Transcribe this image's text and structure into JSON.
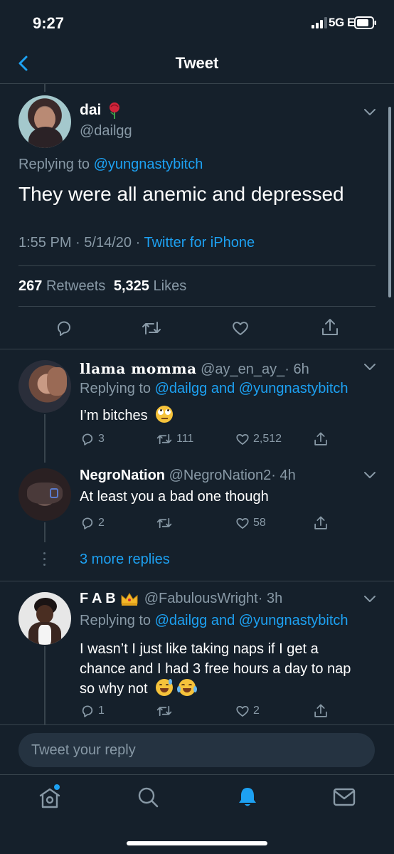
{
  "status_bar": {
    "time": "9:27",
    "network": "5G E"
  },
  "nav": {
    "title": "Tweet"
  },
  "main_tweet": {
    "display_name": "dai",
    "handle": "@dailgg",
    "replying_prefix": "Replying to ",
    "replying_to": "@yungnastybitch",
    "text": "They were all anemic and depressed",
    "time": "1:55 PM",
    "date": "5/14/20",
    "sep1": "·",
    "sep2": "·",
    "source": "Twitter for iPhone",
    "retweets_count": "267",
    "retweets_label": "Retweets",
    "likes_count": "5,325",
    "likes_label": "Likes"
  },
  "replies": [
    {
      "display_name": "llama momma",
      "handle": "@ay_en_ay_",
      "age": "· 6h",
      "replying_prefix": "Replying to ",
      "replying_to_1": "@dailgg",
      "replying_and": " and ",
      "replying_to_2": "@yungnastybitch",
      "text": "I’m bitches",
      "reply_count": "3",
      "retweet_count": "111",
      "like_count": "2,512"
    },
    {
      "display_name": "NegroNation",
      "handle": "@NegroNation2",
      "age": "· 4h",
      "text": "At least you a bad one though",
      "reply_count": "2",
      "retweet_count": "",
      "like_count": "58"
    },
    {
      "display_name": "F A B",
      "handle": "@FabulousWright",
      "age": "· 3h",
      "replying_prefix": "Replying to ",
      "replying_to_1": "@dailgg",
      "replying_and": " and ",
      "replying_to_2": "@yungnastybitch",
      "text_line1": "I wasn’t I just like taking naps if I get a",
      "text_line2": "chance and I had 3 free hours a day to nap",
      "text_line3": "so why not",
      "reply_count": "1",
      "retweet_count": "",
      "like_count": "2"
    }
  ],
  "more_replies": {
    "label": "3 more replies"
  },
  "composer": {
    "placeholder": "Tweet your reply"
  },
  "colors": {
    "background": "#15202b",
    "accent": "#1da1f2",
    "muted": "#8899a6",
    "divider": "#38444d"
  },
  "icons": [
    "back-arrow-icon",
    "rose-emoji",
    "chevron-down-icon",
    "reply-icon",
    "retweet-icon",
    "like-icon",
    "share-icon",
    "rolling-eyes-emoji",
    "crown-emoji",
    "sweat-smile-emoji",
    "joy-emoji",
    "home-icon",
    "search-icon",
    "notifications-icon",
    "messages-icon"
  ]
}
